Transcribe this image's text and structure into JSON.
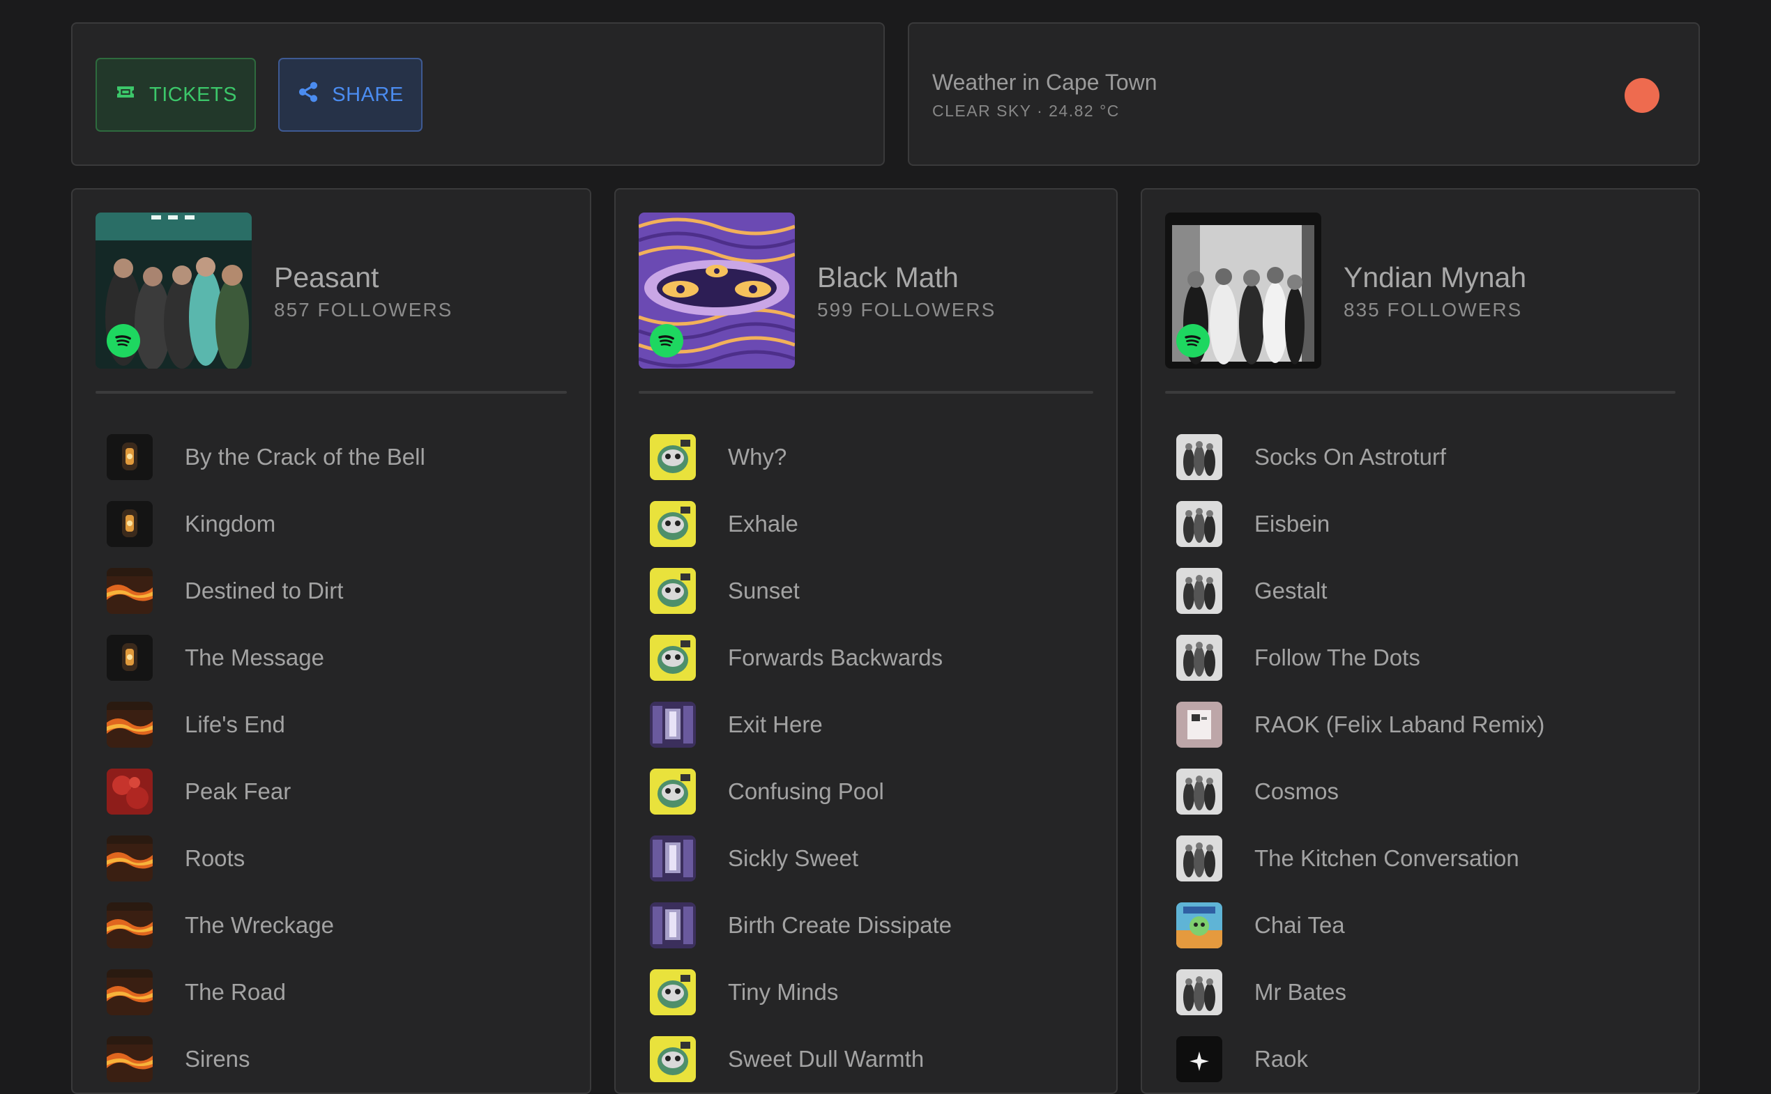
{
  "actions": {
    "tickets_label": "TICKETS",
    "share_label": "SHARE",
    "tickets_icon": "ticket-icon",
    "share_icon": "share-icon",
    "tickets_color": "#3cc76a",
    "share_color": "#4b8cf0"
  },
  "weather": {
    "title": "Weather in Cape Town",
    "subtitle": "CLEAR SKY · 24.82 °C",
    "indicator_color": "#ee6b4f"
  },
  "artists": [
    {
      "name": "Peasant",
      "followers": "857 FOLLOWERS",
      "badge_icon": "spotify-icon",
      "tracks": [
        "By the Crack of the Bell",
        "Kingdom",
        "Destined to Dirt",
        "The Message",
        "Life's End",
        "Peak Fear",
        "Roots",
        "The Wreckage",
        "The Road",
        "Sirens"
      ]
    },
    {
      "name": "Black Math",
      "followers": "599 FOLLOWERS",
      "badge_icon": "spotify-icon",
      "tracks": [
        "Why?",
        "Exhale",
        "Sunset",
        "Forwards Backwards",
        "Exit Here",
        "Confusing Pool",
        "Sickly Sweet",
        "Birth Create Dissipate",
        "Tiny Minds",
        "Sweet Dull Warmth"
      ]
    },
    {
      "name": "Yndian Mynah",
      "followers": "835 FOLLOWERS",
      "badge_icon": "spotify-icon",
      "tracks": [
        "Socks On Astroturf",
        "Eisbein",
        "Gestalt",
        "Follow The Dots",
        "RAOK (Felix Laband Remix)",
        "Cosmos",
        "The Kitchen Conversation",
        "Chai Tea",
        "Mr Bates",
        "Raok"
      ]
    }
  ]
}
